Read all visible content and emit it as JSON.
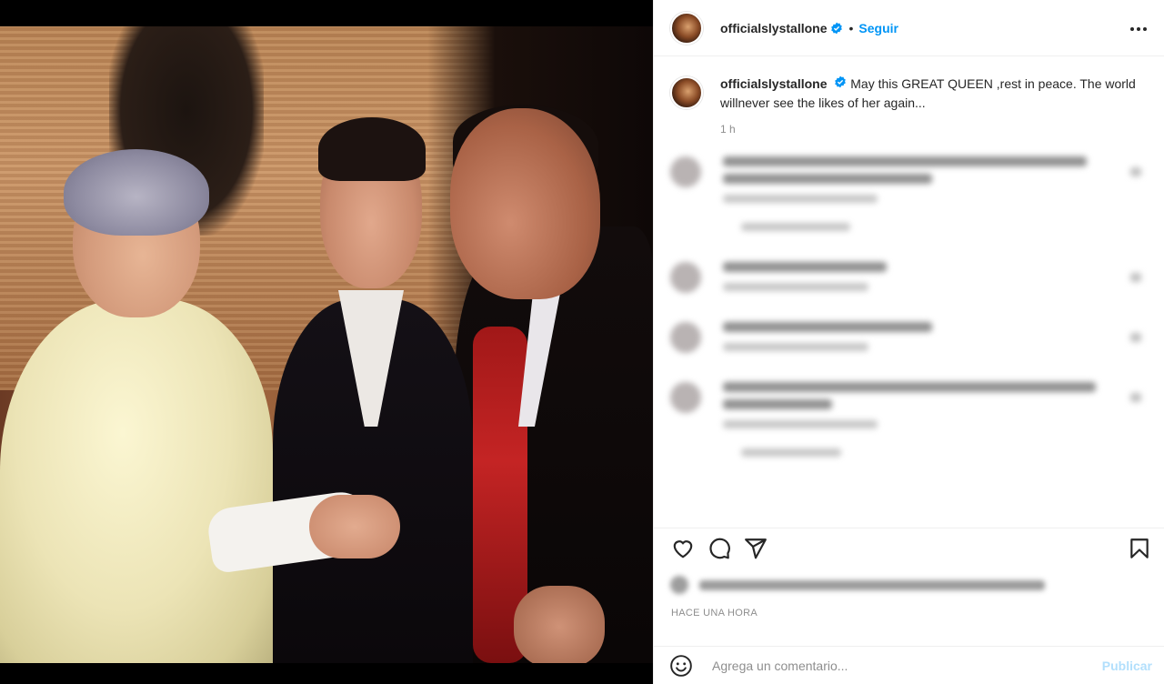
{
  "post": {
    "username": "officialslystallone",
    "follow_label": "Seguir",
    "separator": "•",
    "caption_text": "May this GREAT QUEEN ,rest in peace. The world willnever see the likes of her again...",
    "caption_time": "1 h",
    "time_ago": "HACE UNA HORA"
  },
  "comment_box": {
    "placeholder": "Agrega un comentario...",
    "publish_label": "Publicar"
  },
  "colors": {
    "accent": "#0095f6",
    "publish_disabled": "#b2dffc",
    "text": "#262626",
    "muted": "#8e8e8e"
  },
  "icons": [
    "verified-badge-icon",
    "more-options-icon",
    "heart-icon",
    "comment-icon",
    "share-icon",
    "bookmark-icon",
    "emoji-icon"
  ]
}
